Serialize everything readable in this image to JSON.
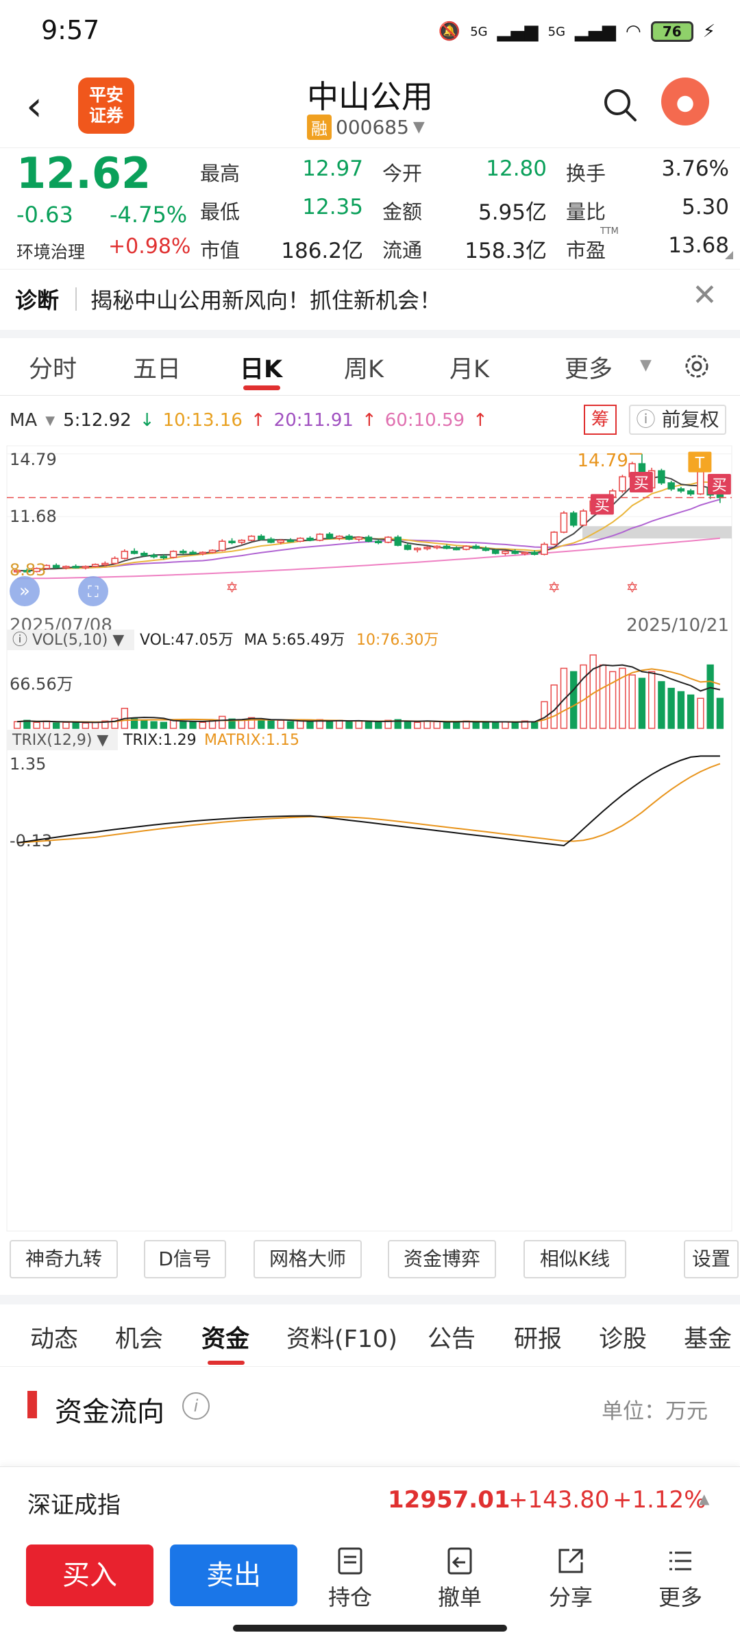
{
  "status": {
    "time": "9:57",
    "battery": "76",
    "network": [
      "5G",
      "5G"
    ]
  },
  "header": {
    "logo_line1": "平安",
    "logo_line2": "证券",
    "title": "中山公用",
    "rong_badge": "融",
    "code": "000685"
  },
  "quote": {
    "price": "12.62",
    "change": "-0.63",
    "change_pct": "-4.75%",
    "env_label": "环境治理",
    "env_value": "+0.98%",
    "fields": [
      {
        "label": "最高",
        "value": "12.97"
      },
      {
        "label": "今开",
        "value": "12.80"
      },
      {
        "label": "换手",
        "value": "3.76%"
      },
      {
        "label": "最低",
        "value": "12.35"
      },
      {
        "label": "金额",
        "value": "5.95亿"
      },
      {
        "label": "量比",
        "value": "5.30"
      },
      {
        "label": "市值",
        "value": "186.2亿"
      },
      {
        "label": "流通",
        "value": "158.3亿"
      },
      {
        "label": "市盈",
        "value": "13.68"
      }
    ],
    "ttm_label": "TTM"
  },
  "diagnosis": {
    "label": "诊断",
    "text": "揭秘中山公用新风向！抓住新机会！"
  },
  "kline_tabs": [
    "分时",
    "五日",
    "日K",
    "周K",
    "月K",
    "更多"
  ],
  "ma": {
    "label": "MA",
    "ma5": "5:12.92",
    "ma10": "10:13.16",
    "ma20": "20:11.91",
    "ma60": "60:10.59"
  },
  "chip_button": "筹",
  "fuquan_button": "前复权",
  "chart_data": {
    "type": "candlestick",
    "y_labels": {
      "top": "14.79",
      "mid": "11.68",
      "low": "8.83"
    },
    "high_annotation": "14.79",
    "date_start": "2025/07/08",
    "date_end": "2025/10/21",
    "current_price": 12.62,
    "buy_markers": [
      "买",
      "买",
      "买"
    ],
    "t_marker": "T",
    "ohlc": [
      [
        8.95,
        9.05,
        8.85,
        9.0
      ],
      [
        9.0,
        9.1,
        8.9,
        8.95
      ],
      [
        8.95,
        9.15,
        8.9,
        9.1
      ],
      [
        9.1,
        9.3,
        9.05,
        9.25
      ],
      [
        9.25,
        9.35,
        9.1,
        9.15
      ],
      [
        9.15,
        9.25,
        9.05,
        9.2
      ],
      [
        9.2,
        9.3,
        9.1,
        9.15
      ],
      [
        9.15,
        9.25,
        9.05,
        9.2
      ],
      [
        9.2,
        9.35,
        9.15,
        9.3
      ],
      [
        9.3,
        9.45,
        9.2,
        9.35
      ],
      [
        9.35,
        9.7,
        9.3,
        9.6
      ],
      [
        9.6,
        10.05,
        9.55,
        9.95
      ],
      [
        9.95,
        10.1,
        9.8,
        9.85
      ],
      [
        9.85,
        9.95,
        9.7,
        9.75
      ],
      [
        9.75,
        9.85,
        9.6,
        9.7
      ],
      [
        9.7,
        9.8,
        9.55,
        9.65
      ],
      [
        9.65,
        10.0,
        9.6,
        9.95
      ],
      [
        9.95,
        10.05,
        9.8,
        9.9
      ],
      [
        9.9,
        10.0,
        9.8,
        9.85
      ],
      [
        9.85,
        9.95,
        9.75,
        9.9
      ],
      [
        9.9,
        10.05,
        9.85,
        10.0
      ],
      [
        10.0,
        10.55,
        9.95,
        10.45
      ],
      [
        10.45,
        10.6,
        10.3,
        10.4
      ],
      [
        10.4,
        10.55,
        10.3,
        10.5
      ],
      [
        10.5,
        10.75,
        10.45,
        10.7
      ],
      [
        10.7,
        10.8,
        10.5,
        10.55
      ],
      [
        10.55,
        10.65,
        10.35,
        10.4
      ],
      [
        10.4,
        10.55,
        10.3,
        10.5
      ],
      [
        10.5,
        10.6,
        10.4,
        10.45
      ],
      [
        10.45,
        10.65,
        10.4,
        10.6
      ],
      [
        10.6,
        10.7,
        10.45,
        10.5
      ],
      [
        10.5,
        10.85,
        10.45,
        10.8
      ],
      [
        10.8,
        10.9,
        10.55,
        10.6
      ],
      [
        10.6,
        10.75,
        10.5,
        10.7
      ],
      [
        10.7,
        10.8,
        10.5,
        10.55
      ],
      [
        10.55,
        10.7,
        10.45,
        10.65
      ],
      [
        10.65,
        10.75,
        10.4,
        10.45
      ],
      [
        10.45,
        10.55,
        10.3,
        10.4
      ],
      [
        10.4,
        10.7,
        10.35,
        10.65
      ],
      [
        10.65,
        10.75,
        10.2,
        10.25
      ],
      [
        10.25,
        10.35,
        10.0,
        10.05
      ],
      [
        10.05,
        10.15,
        9.9,
        10.1
      ],
      [
        10.1,
        10.2,
        10.0,
        10.15
      ],
      [
        10.15,
        10.25,
        10.05,
        10.2
      ],
      [
        10.2,
        10.3,
        10.05,
        10.1
      ],
      [
        10.1,
        10.2,
        10.0,
        10.05
      ],
      [
        10.05,
        10.25,
        10.0,
        10.2
      ],
      [
        10.2,
        10.3,
        10.05,
        10.1
      ],
      [
        10.1,
        10.2,
        9.95,
        10.0
      ],
      [
        10.0,
        10.05,
        9.8,
        9.85
      ],
      [
        9.85,
        10.0,
        9.75,
        9.95
      ],
      [
        9.95,
        10.05,
        9.8,
        9.85
      ],
      [
        9.85,
        9.95,
        9.75,
        9.9
      ],
      [
        9.9,
        10.0,
        9.75,
        9.8
      ],
      [
        9.8,
        10.4,
        9.75,
        10.3
      ],
      [
        10.3,
        10.95,
        10.25,
        10.9
      ],
      [
        10.9,
        11.95,
        10.85,
        11.85
      ],
      [
        11.85,
        11.95,
        11.15,
        11.25
      ],
      [
        11.25,
        12.05,
        11.2,
        11.95
      ],
      [
        11.95,
        12.55,
        11.9,
        12.45
      ],
      [
        12.45,
        12.75,
        12.2,
        12.65
      ],
      [
        12.65,
        13.05,
        12.5,
        12.95
      ],
      [
        12.95,
        13.75,
        12.85,
        13.65
      ],
      [
        13.65,
        14.4,
        13.55,
        14.3
      ],
      [
        14.3,
        14.79,
        12.9,
        13.1
      ],
      [
        13.1,
        14.1,
        13.0,
        13.95
      ],
      [
        13.95,
        14.05,
        13.25,
        13.35
      ],
      [
        13.35,
        13.45,
        12.95,
        13.05
      ],
      [
        13.05,
        13.15,
        12.85,
        12.95
      ],
      [
        12.95,
        13.05,
        12.7,
        12.8
      ],
      [
        12.8,
        14.0,
        12.75,
        13.9
      ],
      [
        13.1,
        13.15,
        12.55,
        12.75
      ],
      [
        12.8,
        12.97,
        12.35,
        12.62
      ]
    ]
  },
  "volume": {
    "header": "VOL(5,10)",
    "vol": "VOL:47.05万",
    "ma5": "MA 5:65.49万",
    "ma10": "10:76.30万",
    "y_label": "66.56万",
    "values": [
      10,
      12,
      9,
      11,
      8,
      9,
      10,
      8,
      9,
      11,
      15,
      30,
      14,
      12,
      10,
      9,
      13,
      11,
      10,
      9,
      12,
      18,
      14,
      13,
      16,
      12,
      11,
      12,
      10,
      11,
      10,
      13,
      11,
      12,
      10,
      11,
      10,
      9,
      12,
      13,
      10,
      9,
      11,
      10,
      9,
      10,
      11,
      9,
      10,
      9,
      10,
      9,
      11,
      10,
      40,
      65,
      90,
      85,
      95,
      110,
      95,
      85,
      90,
      80,
      75,
      85,
      70,
      60,
      55,
      50,
      45,
      95,
      45
    ]
  },
  "trix": {
    "header": "TRIX(12,9)",
    "trix": "TRIX:1.29",
    "matrix": "MATRIX:1.15",
    "y_top": "1.35",
    "y_bottom": "-0.13"
  },
  "tools": [
    "神奇九转",
    "D信号",
    "网格大师",
    "资金博弈",
    "相似K线",
    "设置"
  ],
  "f10_tabs": [
    "动态",
    "机会",
    "资金",
    "资料(F10)",
    "公告",
    "研报",
    "诊股",
    "基金"
  ],
  "fund": {
    "title": "资金流向",
    "unit": "单位：万元"
  },
  "index": {
    "name": "深证成指",
    "value": "12957.01",
    "change": "+143.80",
    "pct": "+1.12%"
  },
  "bottom": {
    "buy": "买入",
    "sell": "卖出",
    "items": [
      "持仓",
      "撤单",
      "分享",
      "更多"
    ]
  }
}
